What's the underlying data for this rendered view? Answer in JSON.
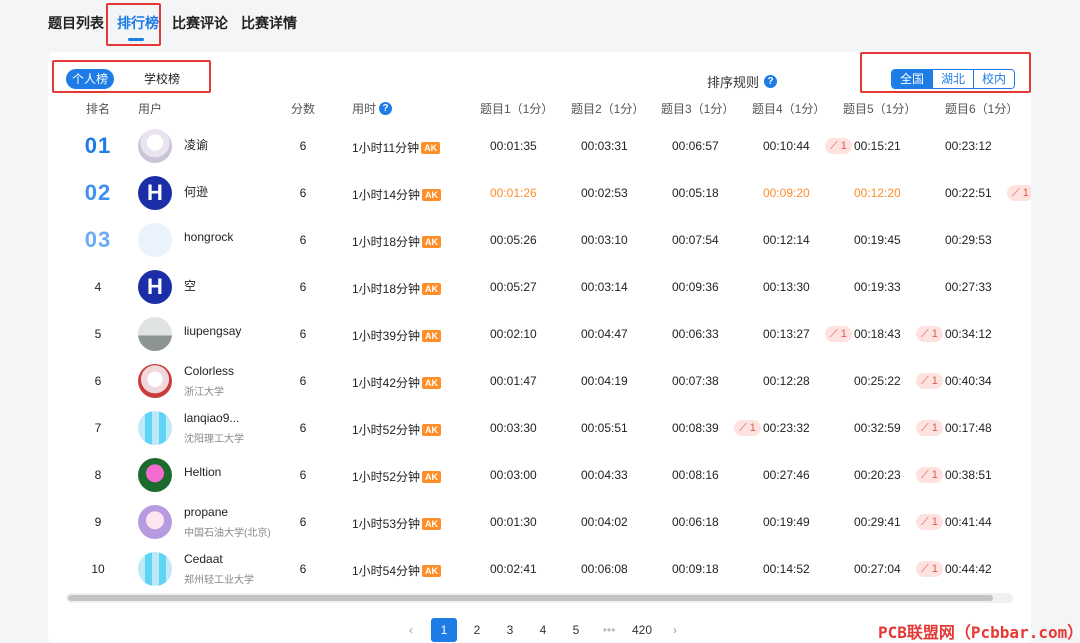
{
  "tabs": {
    "problems": "题目列表",
    "ranking": "排行榜",
    "comments": "比赛评论",
    "details": "比赛详情"
  },
  "toggle": {
    "personal": "个人榜",
    "school": "学校榜"
  },
  "sort_rule": "排序规则",
  "region": {
    "national": "全国",
    "hubei": "湖北",
    "campus": "校内"
  },
  "headers": {
    "rank": "排名",
    "user": "用户",
    "score": "分数",
    "time": "用时",
    "p1": "题目1（1分）",
    "p2": "题目2（1分）",
    "p3": "题目3（1分）",
    "p4": "题目4（1分）",
    "p5": "题目5（1分）",
    "p6": "题目6（1分）"
  },
  "ak_label": "AK",
  "wa_label": "1",
  "rows": [
    {
      "rank": "01",
      "name": "凌谕",
      "school": "",
      "score": "6",
      "time": "1小时11分钟",
      "p1": "00:01:35",
      "p2": "00:03:31",
      "p3": "00:06:57",
      "p4": "00:10:44",
      "p5": "00:15:21",
      "p6": "00:23:12"
    },
    {
      "rank": "02",
      "name": "何逊",
      "school": "",
      "score": "6",
      "time": "1小时14分钟",
      "p1": "00:01:26",
      "p2": "00:02:53",
      "p3": "00:05:18",
      "p4": "00:09:20",
      "p5": "00:12:20",
      "p6": "00:22:51"
    },
    {
      "rank": "03",
      "name": "hongrock",
      "school": "",
      "score": "6",
      "time": "1小时18分钟",
      "p1": "00:05:26",
      "p2": "00:03:10",
      "p3": "00:07:54",
      "p4": "00:12:14",
      "p5": "00:19:45",
      "p6": "00:29:53"
    },
    {
      "rank": "4",
      "name": "空",
      "school": "",
      "score": "6",
      "time": "1小时18分钟",
      "p1": "00:05:27",
      "p2": "00:03:14",
      "p3": "00:09:36",
      "p4": "00:13:30",
      "p5": "00:19:33",
      "p6": "00:27:33"
    },
    {
      "rank": "5",
      "name": "liupengsay",
      "school": "",
      "score": "6",
      "time": "1小时39分钟",
      "p1": "00:02:10",
      "p2": "00:04:47",
      "p3": "00:06:33",
      "p4": "00:13:27",
      "p5": "00:18:43",
      "p6": "00:34:12"
    },
    {
      "rank": "6",
      "name": "Colorless",
      "school": "浙江大学",
      "score": "6",
      "time": "1小时42分钟",
      "p1": "00:01:47",
      "p2": "00:04:19",
      "p3": "00:07:38",
      "p4": "00:12:28",
      "p5": "00:25:22",
      "p6": "00:40:34"
    },
    {
      "rank": "7",
      "name": "lanqiao9...",
      "school": "沈阳理工大学",
      "score": "6",
      "time": "1小时52分钟",
      "p1": "00:03:30",
      "p2": "00:05:51",
      "p3": "00:08:39",
      "p4": "00:23:32",
      "p5": "00:32:59",
      "p6": "00:17:48"
    },
    {
      "rank": "8",
      "name": "Heltion",
      "school": "",
      "score": "6",
      "time": "1小时52分钟",
      "p1": "00:03:00",
      "p2": "00:04:33",
      "p3": "00:08:16",
      "p4": "00:27:46",
      "p5": "00:20:23",
      "p6": "00:38:51"
    },
    {
      "rank": "9",
      "name": "propane",
      "school": "中国石油大学(北京)",
      "score": "6",
      "time": "1小时53分钟",
      "p1": "00:01:30",
      "p2": "00:04:02",
      "p3": "00:06:18",
      "p4": "00:19:49",
      "p5": "00:29:41",
      "p6": "00:41:44"
    },
    {
      "rank": "10",
      "name": "Cedaat",
      "school": "郑州轻工业大学",
      "score": "6",
      "time": "1小时54分钟",
      "p1": "00:02:41",
      "p2": "00:06:08",
      "p3": "00:09:18",
      "p4": "00:14:52",
      "p5": "00:27:04",
      "p6": "00:44:42"
    }
  ],
  "pager": {
    "prev": "‹",
    "p1": "1",
    "p2": "2",
    "p3": "3",
    "p4": "4",
    "p5": "5",
    "dots": "•••",
    "last": "420",
    "next": "›"
  },
  "watermark": "PCB联盟网（Pcbbar.com）",
  "colors": {
    "accent": "#1e7ce6",
    "first_solve": "#ff8d28",
    "wa_bg": "#fde2df",
    "ak_bg": "#ff8d28",
    "highlight_box": "#e53935"
  }
}
